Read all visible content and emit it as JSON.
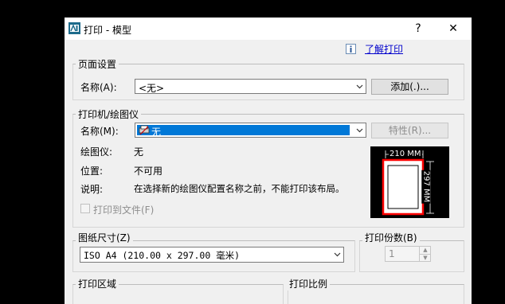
{
  "window": {
    "title": "打印 - 模型",
    "help_label": "?",
    "close_label": "✕",
    "help_link": "了解打印"
  },
  "page_setup": {
    "group_title": "页面设置",
    "name_label": "名称(A):",
    "name_value": "<无>",
    "add_button": "添加(.)..."
  },
  "printer": {
    "group_title": "打印机/绘图仪",
    "name_label": "名称(M):",
    "name_value": "无",
    "properties_button": "特性(R)...",
    "plotter_label": "绘图仪:",
    "plotter_value": "无",
    "location_label": "位置:",
    "location_value": "不可用",
    "description_label": "说明:",
    "description_value": "在选择新的绘图仪配置名称之前，不能打印该布局。",
    "print_to_file_label": "打印到文件(F)",
    "preview_width_label": "210 MM",
    "preview_height_label": "297 MM"
  },
  "paper_size": {
    "group_title": "图纸尺寸(Z)",
    "value": "ISO A4 (210.00 x 297.00 毫米)"
  },
  "copies": {
    "group_title": "打印份数(B)",
    "value": "1"
  },
  "plot_area": {
    "group_title": "打印区域"
  },
  "plot_scale": {
    "group_title": "打印比例"
  },
  "colors": {
    "selection": "#0078d7",
    "preview_border": "#ff0000"
  }
}
